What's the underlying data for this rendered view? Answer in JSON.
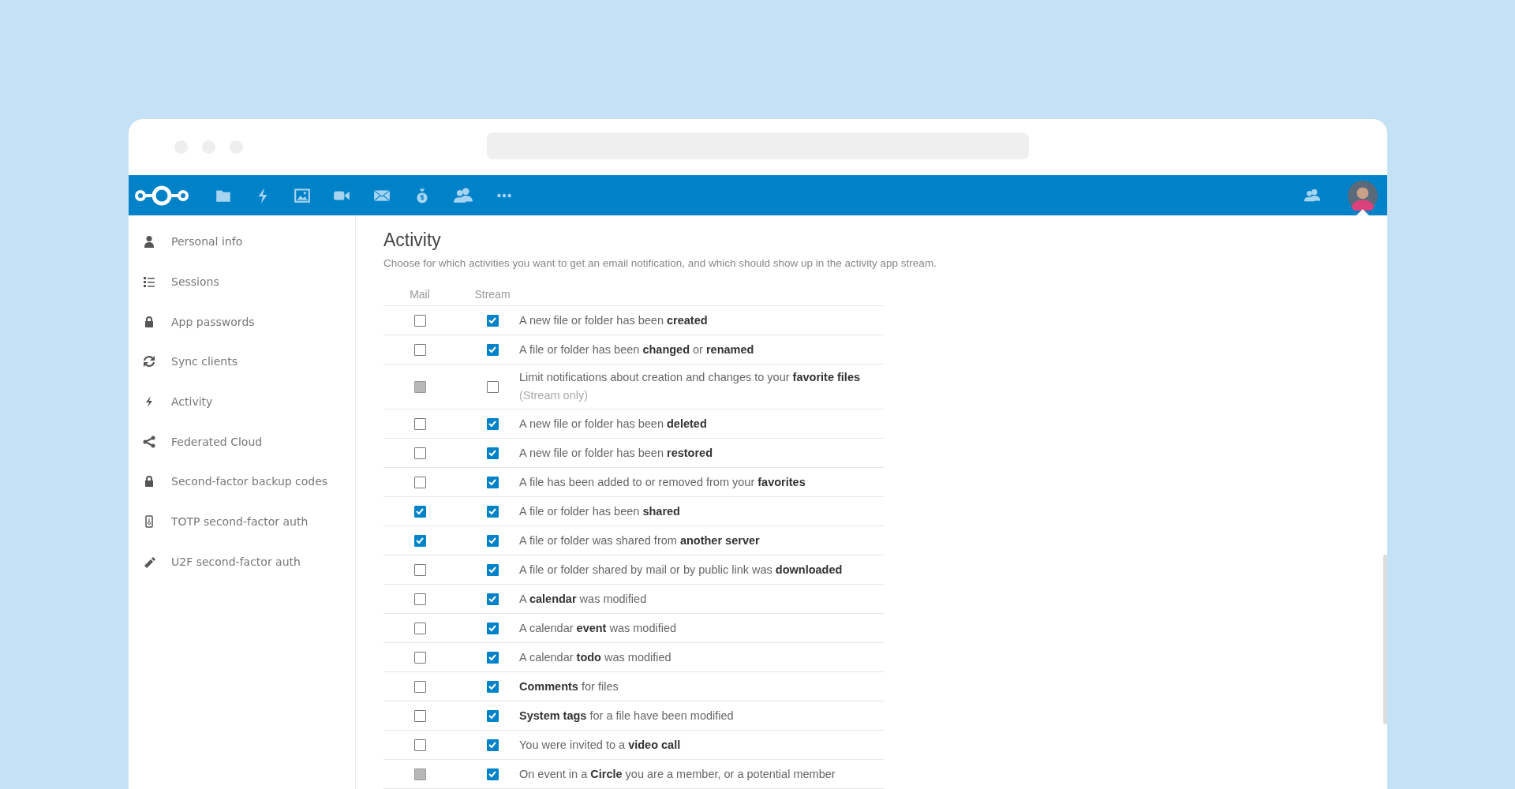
{
  "sidebar": {
    "items": [
      {
        "label": "Personal info"
      },
      {
        "label": "Sessions"
      },
      {
        "label": "App passwords"
      },
      {
        "label": "Sync clients"
      },
      {
        "label": "Activity"
      },
      {
        "label": "Federated Cloud"
      },
      {
        "label": "Second-factor backup codes"
      },
      {
        "label": "TOTP second-factor auth"
      },
      {
        "label": "U2F second-factor auth"
      }
    ]
  },
  "section": {
    "title": "Activity",
    "description": "Choose for which activities you want to get an email notification, and which should show up in the activity app stream."
  },
  "table": {
    "columns": [
      "Mail",
      "Stream"
    ],
    "rows": [
      {
        "mail": {
          "checked": false,
          "disabled": false
        },
        "stream": {
          "checked": true,
          "disabled": false
        },
        "text": "A new file or folder has been **created**"
      },
      {
        "mail": {
          "checked": false,
          "disabled": false
        },
        "stream": {
          "checked": true,
          "disabled": false
        },
        "text": "A file or folder has been **changed** or **renamed**"
      },
      {
        "mail": {
          "checked": false,
          "disabled": true
        },
        "stream": {
          "checked": false,
          "disabled": false
        },
        "text": "Limit notifications about creation and changes to your **favorite files**",
        "note": "(Stream only)"
      },
      {
        "mail": {
          "checked": false,
          "disabled": false
        },
        "stream": {
          "checked": true,
          "disabled": false
        },
        "text": "A new file or folder has been **deleted**"
      },
      {
        "mail": {
          "checked": false,
          "disabled": false
        },
        "stream": {
          "checked": true,
          "disabled": false
        },
        "text": "A new file or folder has been **restored**"
      },
      {
        "mail": {
          "checked": false,
          "disabled": false
        },
        "stream": {
          "checked": true,
          "disabled": false
        },
        "text": "A file has been added to or removed from your **favorites**"
      },
      {
        "mail": {
          "checked": true,
          "disabled": false
        },
        "stream": {
          "checked": true,
          "disabled": false
        },
        "text": "A file or folder has been **shared**"
      },
      {
        "mail": {
          "checked": true,
          "disabled": false
        },
        "stream": {
          "checked": true,
          "disabled": false
        },
        "text": "A file or folder was shared from **another server**"
      },
      {
        "mail": {
          "checked": false,
          "disabled": false
        },
        "stream": {
          "checked": true,
          "disabled": false
        },
        "text": "A file or folder shared by mail or by public link was **downloaded**"
      },
      {
        "mail": {
          "checked": false,
          "disabled": false
        },
        "stream": {
          "checked": true,
          "disabled": false
        },
        "text": "A **calendar** was modified"
      },
      {
        "mail": {
          "checked": false,
          "disabled": false
        },
        "stream": {
          "checked": true,
          "disabled": false
        },
        "text": "A calendar **event** was modified"
      },
      {
        "mail": {
          "checked": false,
          "disabled": false
        },
        "stream": {
          "checked": true,
          "disabled": false
        },
        "text": "A calendar **todo** was modified"
      },
      {
        "mail": {
          "checked": false,
          "disabled": false
        },
        "stream": {
          "checked": true,
          "disabled": false
        },
        "text": "**Comments** for files"
      },
      {
        "mail": {
          "checked": false,
          "disabled": false
        },
        "stream": {
          "checked": true,
          "disabled": false
        },
        "text": "**System tags** for a file have been modified"
      },
      {
        "mail": {
          "checked": false,
          "disabled": false
        },
        "stream": {
          "checked": true,
          "disabled": false
        },
        "text": "You were invited to a **video call**"
      },
      {
        "mail": {
          "checked": false,
          "disabled": true
        },
        "stream": {
          "checked": true,
          "disabled": false
        },
        "text": "On event in a **Circle** you are a member, or a potential member"
      }
    ]
  }
}
